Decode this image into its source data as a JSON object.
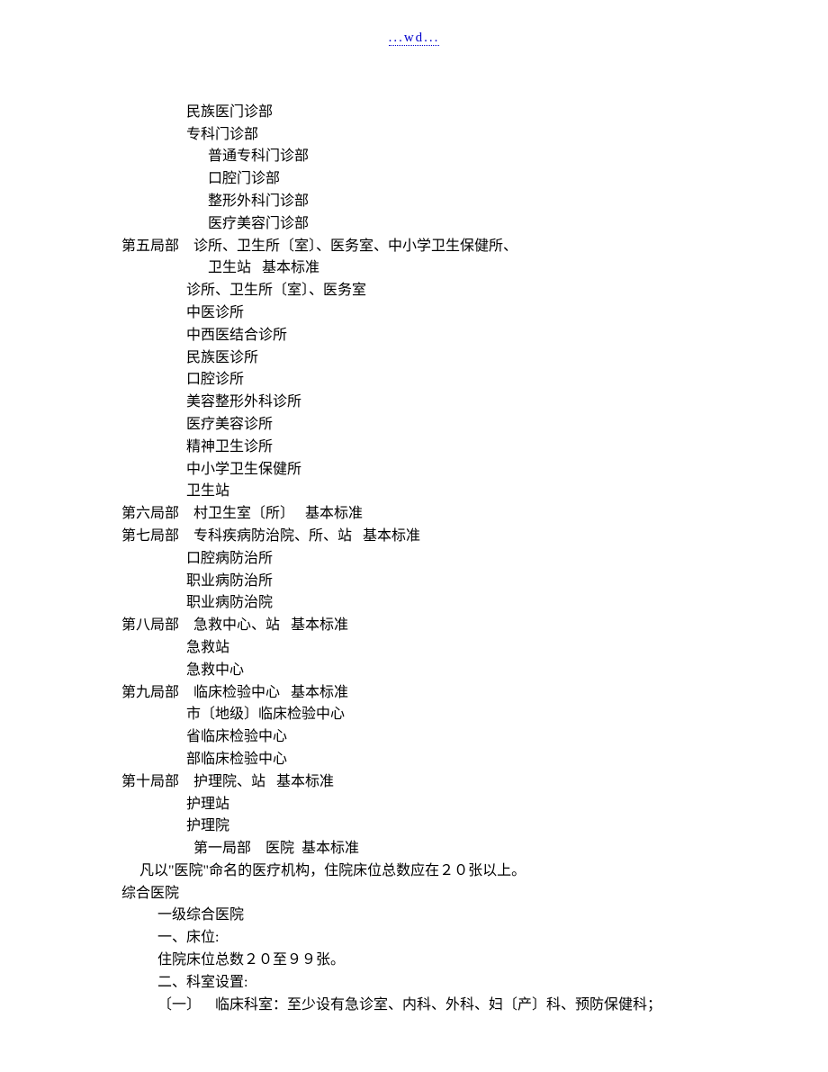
{
  "header_link": "...wd...",
  "lines": [
    "                  民族医门诊部",
    "                  专科门诊部",
    "                        普通专科门诊部",
    "                        口腔门诊部",
    "                        整形外科门诊部",
    "                        医疗美容门诊部",
    "第五局部    诊所、卫生所〔室〕、医务室、中小学卫生保健所、",
    "                        卫生站   基本标准",
    "                  诊所、卫生所〔室〕、医务室",
    "                  中医诊所",
    "                  中西医结合诊所",
    "                  民族医诊所",
    "                  口腔诊所",
    "                  美容整形外科诊所",
    "                  医疗美容诊所",
    "                  精神卫生诊所",
    "                  中小学卫生保健所",
    "                  卫生站",
    "第六局部    村卫生室〔所〕   基本标准",
    "第七局部    专科疾病防治院、所、站   基本标准",
    "                  口腔病防治所",
    "                  职业病防治所",
    "                  职业病防治院",
    "第八局部    急救中心、站   基本标准",
    "                  急救站",
    "                  急救中心",
    "第九局部    临床检验中心   基本标准",
    "                  市〔地级〕临床检验中心",
    "                  省临床检验中心",
    "                  部临床检验中心",
    "第十局部    护理院、站   基本标准",
    "                  护理站",
    "                  护理院",
    "                    第一局部    医院  基本标准",
    "     凡以\"医院\"命名的医疗机构，住院床位总数应在２０张以上。",
    "综合医院",
    "          一级综合医院",
    "          一、床位:",
    "          住院床位总数２０至９９张。",
    "          二、科室设置:",
    "          〔一〕    临床科室：至少设有急诊室、内科、外科、妇〔产〕科、预防保健科；"
  ]
}
